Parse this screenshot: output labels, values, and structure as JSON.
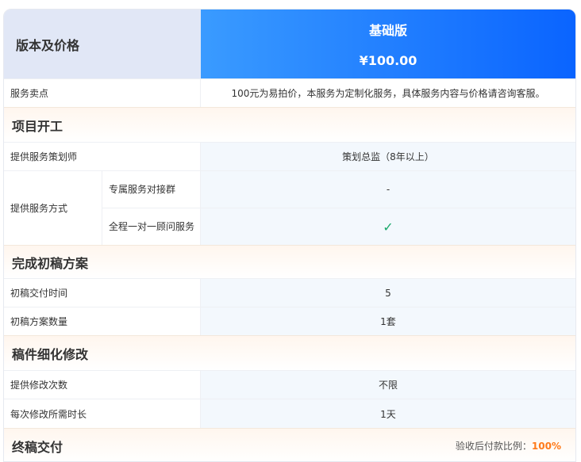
{
  "header": {
    "left_label": "版本及价格",
    "plan_name": "基础版",
    "plan_price": "¥100.00"
  },
  "selling_point": {
    "label": "服务卖点",
    "value": "100元为易拍价，本服务为定制化服务，具体服务内容与价格请咨询客服。"
  },
  "sections": {
    "kickoff": {
      "title": "项目开工",
      "planner_label": "提供服务策划师",
      "planner_value": "策划总监（8年以上）",
      "method_label": "提供服务方式",
      "group_label": "专属服务对接群",
      "group_value": "-",
      "consultant_label": "全程一对一顾问服务",
      "consultant_value_icon": "check-icon"
    },
    "draft": {
      "title": "完成初稿方案",
      "delivery_label": "初稿交付时间",
      "delivery_value": "5",
      "count_label": "初稿方案数量",
      "count_value": "1套"
    },
    "refine": {
      "title": "稿件细化修改",
      "times_label": "提供修改次数",
      "times_value": "不限",
      "duration_label": "每次修改所需时长",
      "duration_value": "1天"
    },
    "final": {
      "title": "终稿交付",
      "ratio_label": "验收后付款比例：",
      "ratio_value": "100%"
    }
  },
  "colors": {
    "accent_blue": "#0a64ff",
    "check_green": "#19a86b",
    "ratio_orange": "#ff7a1a"
  }
}
